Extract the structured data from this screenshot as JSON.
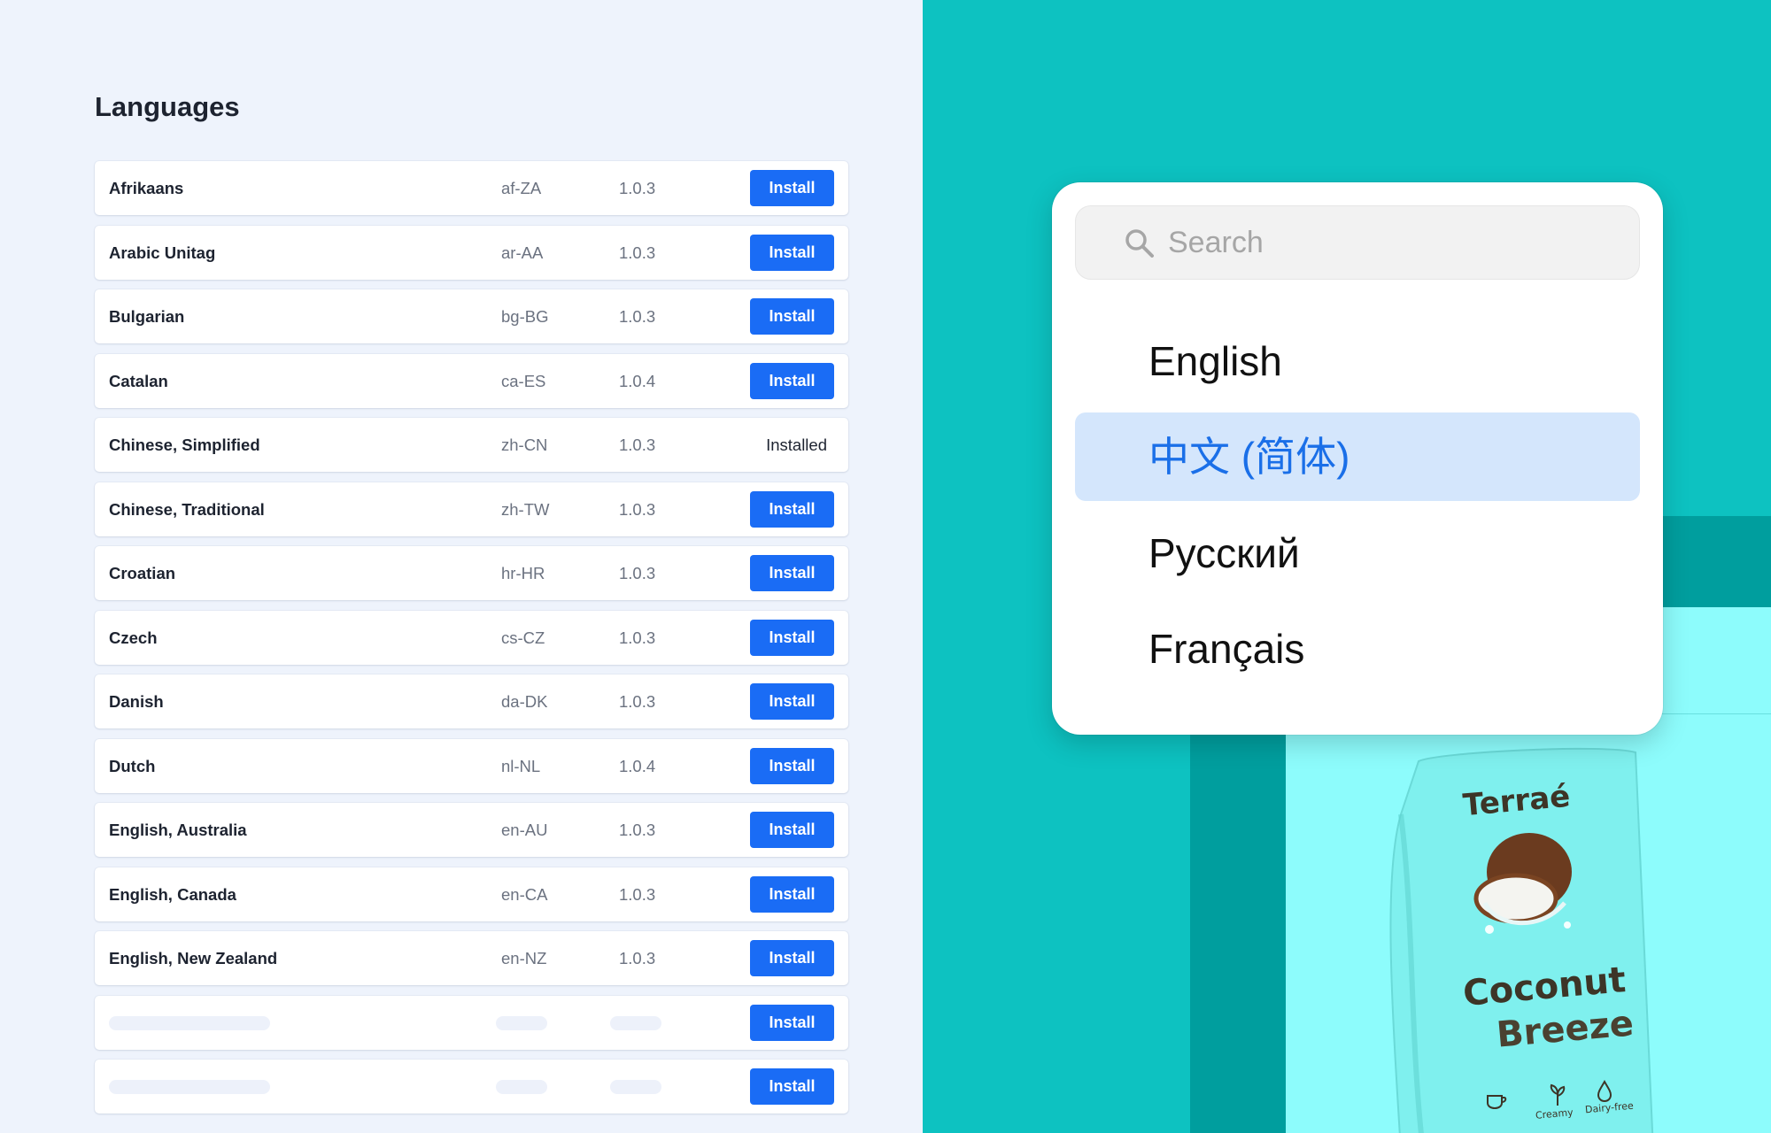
{
  "languages_panel": {
    "title": "Languages",
    "install_label": "Install",
    "rows": [
      {
        "name": "Afrikaans",
        "code": "af-ZA",
        "version": "1.0.3",
        "status": "install"
      },
      {
        "name": "Arabic Unitag",
        "code": "ar-AA",
        "version": "1.0.3",
        "status": "install"
      },
      {
        "name": "Bulgarian",
        "code": "bg-BG",
        "version": "1.0.3",
        "status": "install"
      },
      {
        "name": "Catalan",
        "code": "ca-ES",
        "version": "1.0.4",
        "status": "install"
      },
      {
        "name": "Chinese, Simplified",
        "code": "zh-CN",
        "version": "1.0.3",
        "status": "installed",
        "status_label": "Installed"
      },
      {
        "name": "Chinese, Traditional",
        "code": "zh-TW",
        "version": "1.0.3",
        "status": "install"
      },
      {
        "name": "Croatian",
        "code": "hr-HR",
        "version": "1.0.3",
        "status": "install"
      },
      {
        "name": "Czech",
        "code": "cs-CZ",
        "version": "1.0.3",
        "status": "install"
      },
      {
        "name": "Danish",
        "code": "da-DK",
        "version": "1.0.3",
        "status": "install"
      },
      {
        "name": "Dutch",
        "code": "nl-NL",
        "version": "1.0.4",
        "status": "install"
      },
      {
        "name": "English, Australia",
        "code": "en-AU",
        "version": "1.0.3",
        "status": "install"
      },
      {
        "name": "English, Canada",
        "code": "en-CA",
        "version": "1.0.3",
        "status": "install"
      },
      {
        "name": "English, New Zealand",
        "code": "en-NZ",
        "version": "1.0.3",
        "status": "install"
      }
    ],
    "placeholder_rows": 2
  },
  "language_picker": {
    "search_placeholder": "Search",
    "options": [
      {
        "label": "English",
        "selected": false
      },
      {
        "label": "中文 (简体)",
        "selected": true
      },
      {
        "label": "Русский",
        "selected": false
      },
      {
        "label": "Français",
        "selected": false
      }
    ]
  },
  "product": {
    "brand": "Terraé",
    "name_line1": "Coconut",
    "name_line2": "Breeze",
    "features": [
      "Creamy",
      "Dairy-free"
    ]
  },
  "colors": {
    "accent": "#1a6cf5",
    "background_left": "#eef3fc",
    "teal": "#0dc2c1",
    "teal_dark": "#009e9e",
    "teal_light": "#8dfcfc",
    "selected_bg": "#d4e6fc",
    "selected_text": "#1a6fe8"
  },
  "icons": {
    "search": "search-icon",
    "coffee": "coffee-cup-icon",
    "plant": "plant-icon",
    "drop": "water-drop-icon"
  }
}
